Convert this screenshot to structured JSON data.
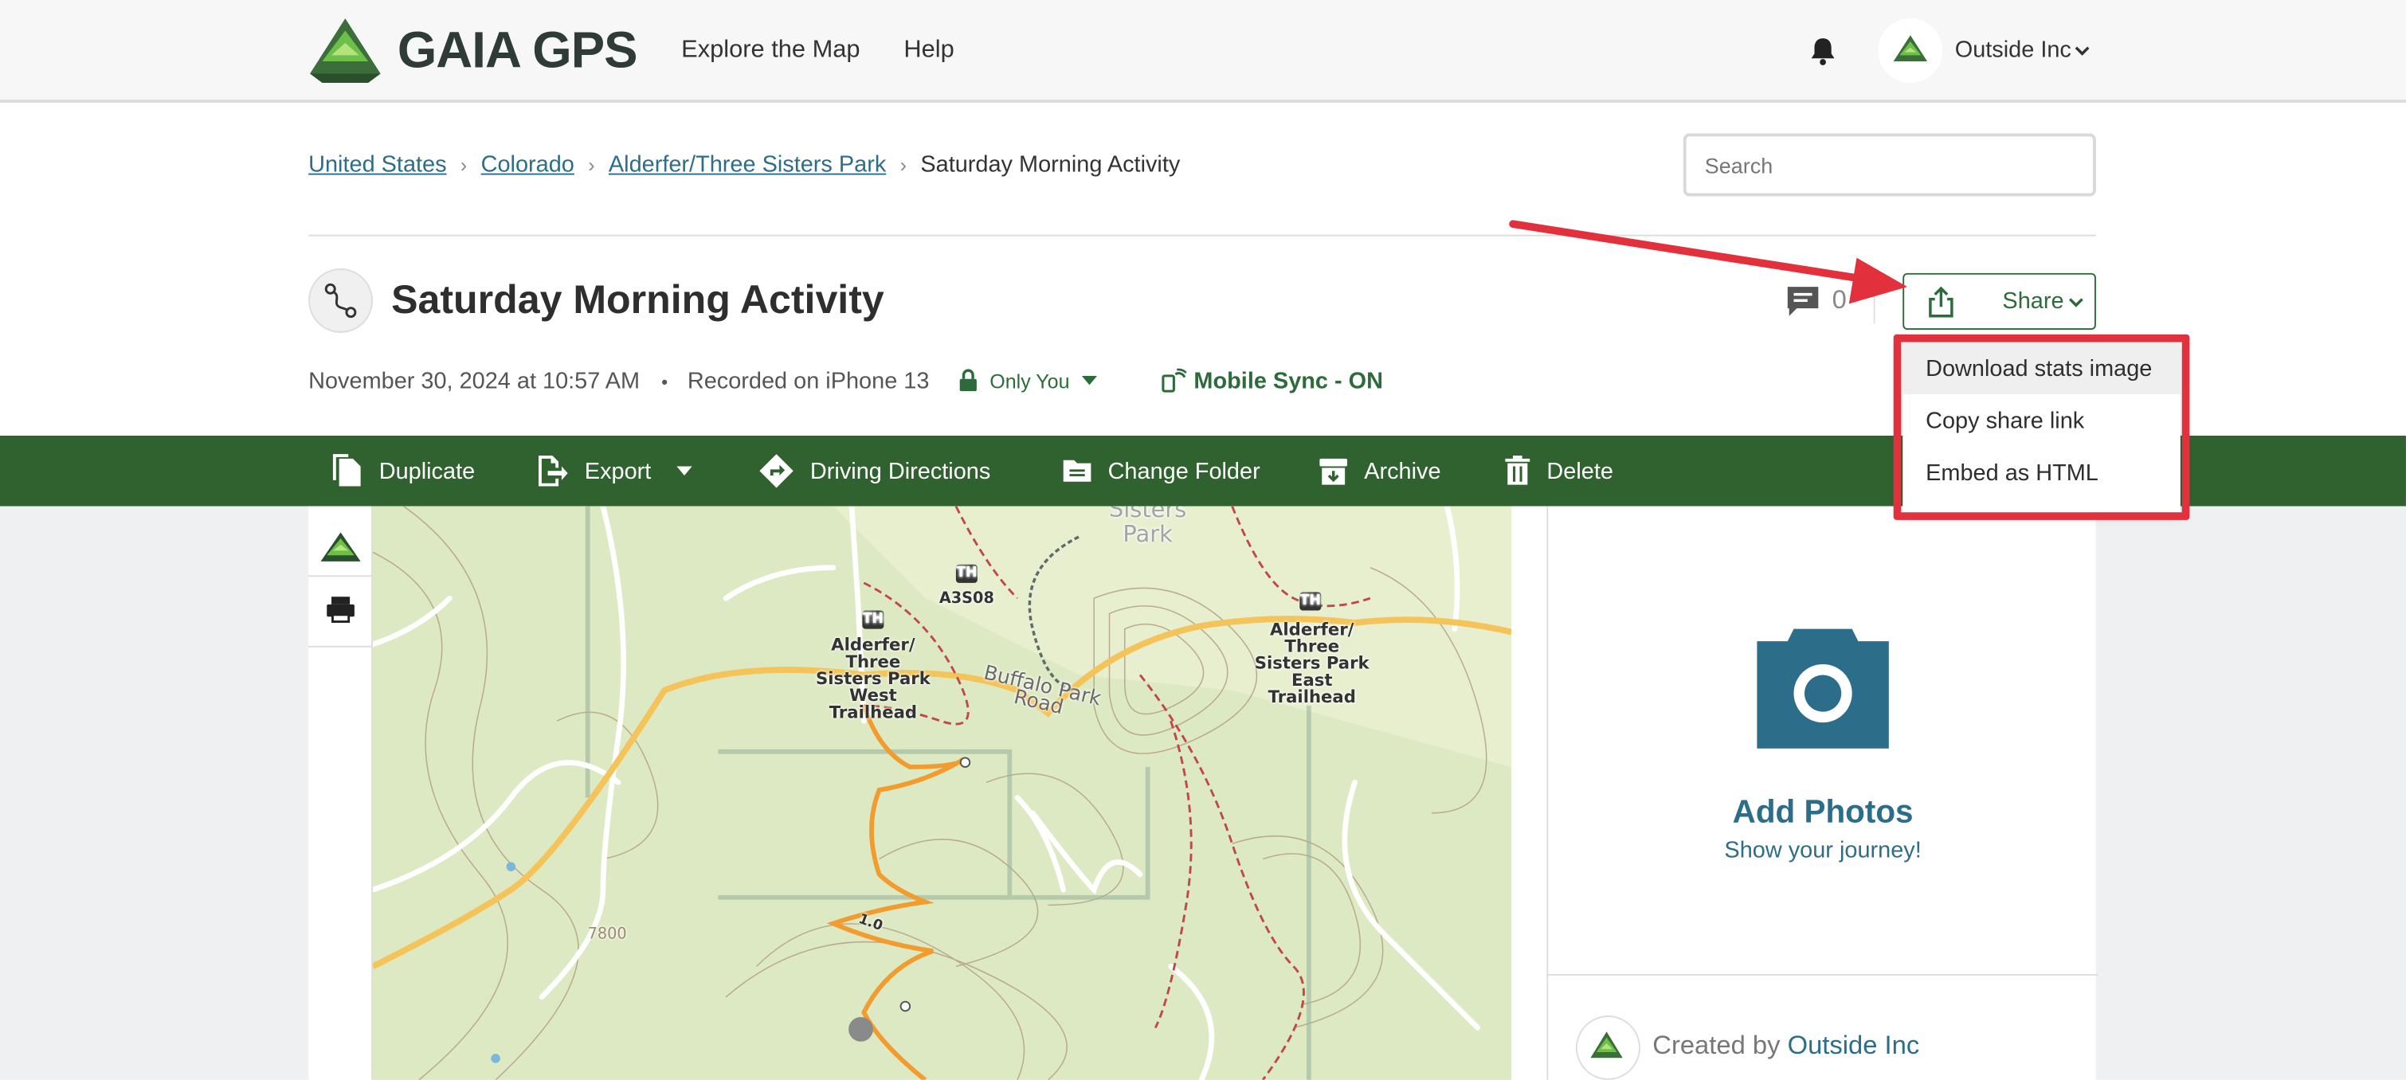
{
  "header": {
    "brand": "GAIA GPS",
    "nav": [
      "Explore the Map",
      "Help"
    ],
    "user": "Outside Inc"
  },
  "breadcrumb": {
    "items": [
      "United States",
      "Colorado",
      "Alderfer/Three Sisters Park"
    ],
    "current": "Saturday Morning Activity",
    "separator": "›"
  },
  "search": {
    "placeholder": "Search"
  },
  "activity": {
    "title": "Saturday Morning Activity",
    "comment_count": "0",
    "share_label": "Share",
    "date": "November 30, 2024 at 10:57 AM",
    "dot": "•",
    "recorded": "Recorded on iPhone 13",
    "privacy": "Only You",
    "sync": "Mobile Sync - ON"
  },
  "share_menu": {
    "items": [
      "Download stats image",
      "Copy share link",
      "Embed as HTML"
    ],
    "hovered_index": 0
  },
  "toolbar": {
    "duplicate": "Duplicate",
    "export": "Export",
    "directions": "Driving Directions",
    "change_folder": "Change Folder",
    "archive": "Archive",
    "delete": "Delete"
  },
  "map": {
    "labels": {
      "park": "Sisters Park",
      "th": "TH",
      "a3s08": "A3S08",
      "west_trailhead": "Alderfer/ Three Sisters Park West Trailhead",
      "east_trailhead": "Alderfer/ Three Sisters Park East Trailhead",
      "road": "Buffalo Park Road",
      "contour": "7800",
      "mile": "1.0"
    }
  },
  "photos": {
    "title": "Add Photos",
    "subtitle": "Show your journey!",
    "created_by": "Created by",
    "creator": "Outside Inc"
  },
  "colors": {
    "brand_green": "#30622f",
    "link_blue": "#2c6d8a",
    "annotation_red": "#e2313c",
    "track_orange": "#f5a623"
  }
}
